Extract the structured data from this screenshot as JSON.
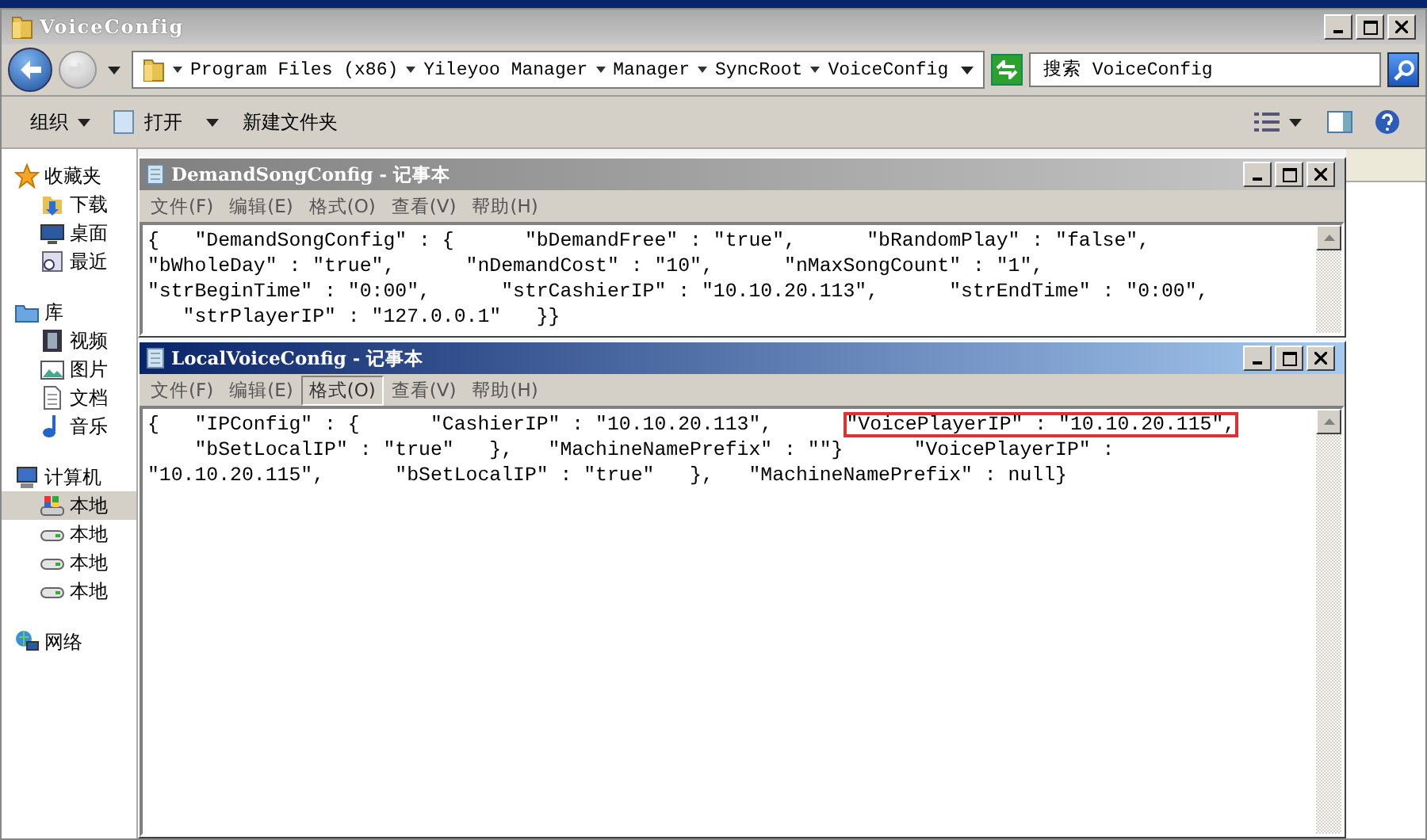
{
  "explorer": {
    "title": "VoiceConfig",
    "breadcrumbs": [
      "Program Files (x86)",
      "Yileyoo Manager",
      "Manager",
      "SyncRoot",
      "VoiceConfig"
    ],
    "search": {
      "placeholder": "搜索 VoiceConfig"
    },
    "toolbar": [
      {
        "label": "组织",
        "kind": "menu"
      },
      {
        "label": "打开",
        "kind": "open"
      },
      {
        "label": "新建文件夹",
        "kind": "plain"
      }
    ],
    "sidebar": [
      {
        "label": "收藏夹",
        "kind": "star",
        "selected": false,
        "children": [
          {
            "label": "下载",
            "kind": "download",
            "selected": false
          },
          {
            "label": "桌面",
            "kind": "desktop",
            "selected": false
          },
          {
            "label": "最近",
            "kind": "recent",
            "selected": false
          }
        ]
      },
      {
        "label": "库",
        "kind": "library",
        "selected": false,
        "children": [
          {
            "label": "视频",
            "kind": "video",
            "selected": false
          },
          {
            "label": "图片",
            "kind": "picture",
            "selected": false
          },
          {
            "label": "文档",
            "kind": "document",
            "selected": false
          },
          {
            "label": "音乐",
            "kind": "music",
            "selected": false
          }
        ]
      },
      {
        "label": "计算机",
        "kind": "computer",
        "selected": false,
        "children": [
          {
            "label": "本地",
            "kind": "system-drive",
            "selected": true
          },
          {
            "label": "本地",
            "kind": "drive",
            "selected": false
          },
          {
            "label": "本地",
            "kind": "drive",
            "selected": false
          },
          {
            "label": "本地",
            "kind": "drive",
            "selected": false
          }
        ]
      },
      {
        "label": "网络",
        "kind": "network",
        "selected": false
      }
    ]
  },
  "notepads": [
    {
      "title": "DemandSongConfig - 记事本",
      "active": false,
      "menu": [
        {
          "label": "文件(F)",
          "selected": false
        },
        {
          "label": "编辑(E)",
          "selected": false
        },
        {
          "label": "格式(O)",
          "selected": false
        },
        {
          "label": "查看(V)",
          "selected": false
        },
        {
          "label": "帮助(H)",
          "selected": false
        }
      ],
      "lines": [
        [
          {
            "text": "{   \"DemandSongConfig\" : {      \"bDemandFree\" : \"true\",      \"bRandomPlay\" : \"false\",",
            "highlighted": false
          }
        ],
        [
          {
            "text": "\"bWholeDay\" : \"true\",      \"nDemandCost\" : \"10\",      \"nMaxSongCount\" : \"1\",",
            "highlighted": false
          }
        ],
        [
          {
            "text": "\"strBeginTime\" : \"0:00\",      \"strCashierIP\" : \"10.10.20.113\",      \"strEndTime\" : \"0:00\",",
            "highlighted": false
          }
        ],
        [
          {
            "text": "   \"strPlayerIP\" : \"127.0.0.1\"   }}",
            "highlighted": false
          }
        ]
      ]
    },
    {
      "title": "LocalVoiceConfig - 记事本",
      "active": true,
      "menu": [
        {
          "label": "文件(F)",
          "selected": false
        },
        {
          "label": "编辑(E)",
          "selected": false
        },
        {
          "label": "格式(O)",
          "selected": true
        },
        {
          "label": "查看(V)",
          "selected": false
        },
        {
          "label": "帮助(H)",
          "selected": false
        }
      ],
      "lines": [
        [
          {
            "text": "{   \"IPConfig\" : {      \"CashierIP\" : \"10.10.20.113\",      ",
            "highlighted": false
          },
          {
            "text": "\"VoicePlayerIP\" : \"10.10.20.115\",",
            "highlighted": true
          }
        ],
        [
          {
            "text": "    \"bSetLocalIP\" : \"true\"   },   \"MachineNamePrefix\" : \"\"}      \"VoicePlayerIP\" :",
            "highlighted": false
          }
        ],
        [
          {
            "text": "\"10.10.20.115\",      \"bSetLocalIP\" : \"true\"   },   \"MachineNamePrefix\" : null}",
            "highlighted": false
          }
        ]
      ]
    }
  ]
}
